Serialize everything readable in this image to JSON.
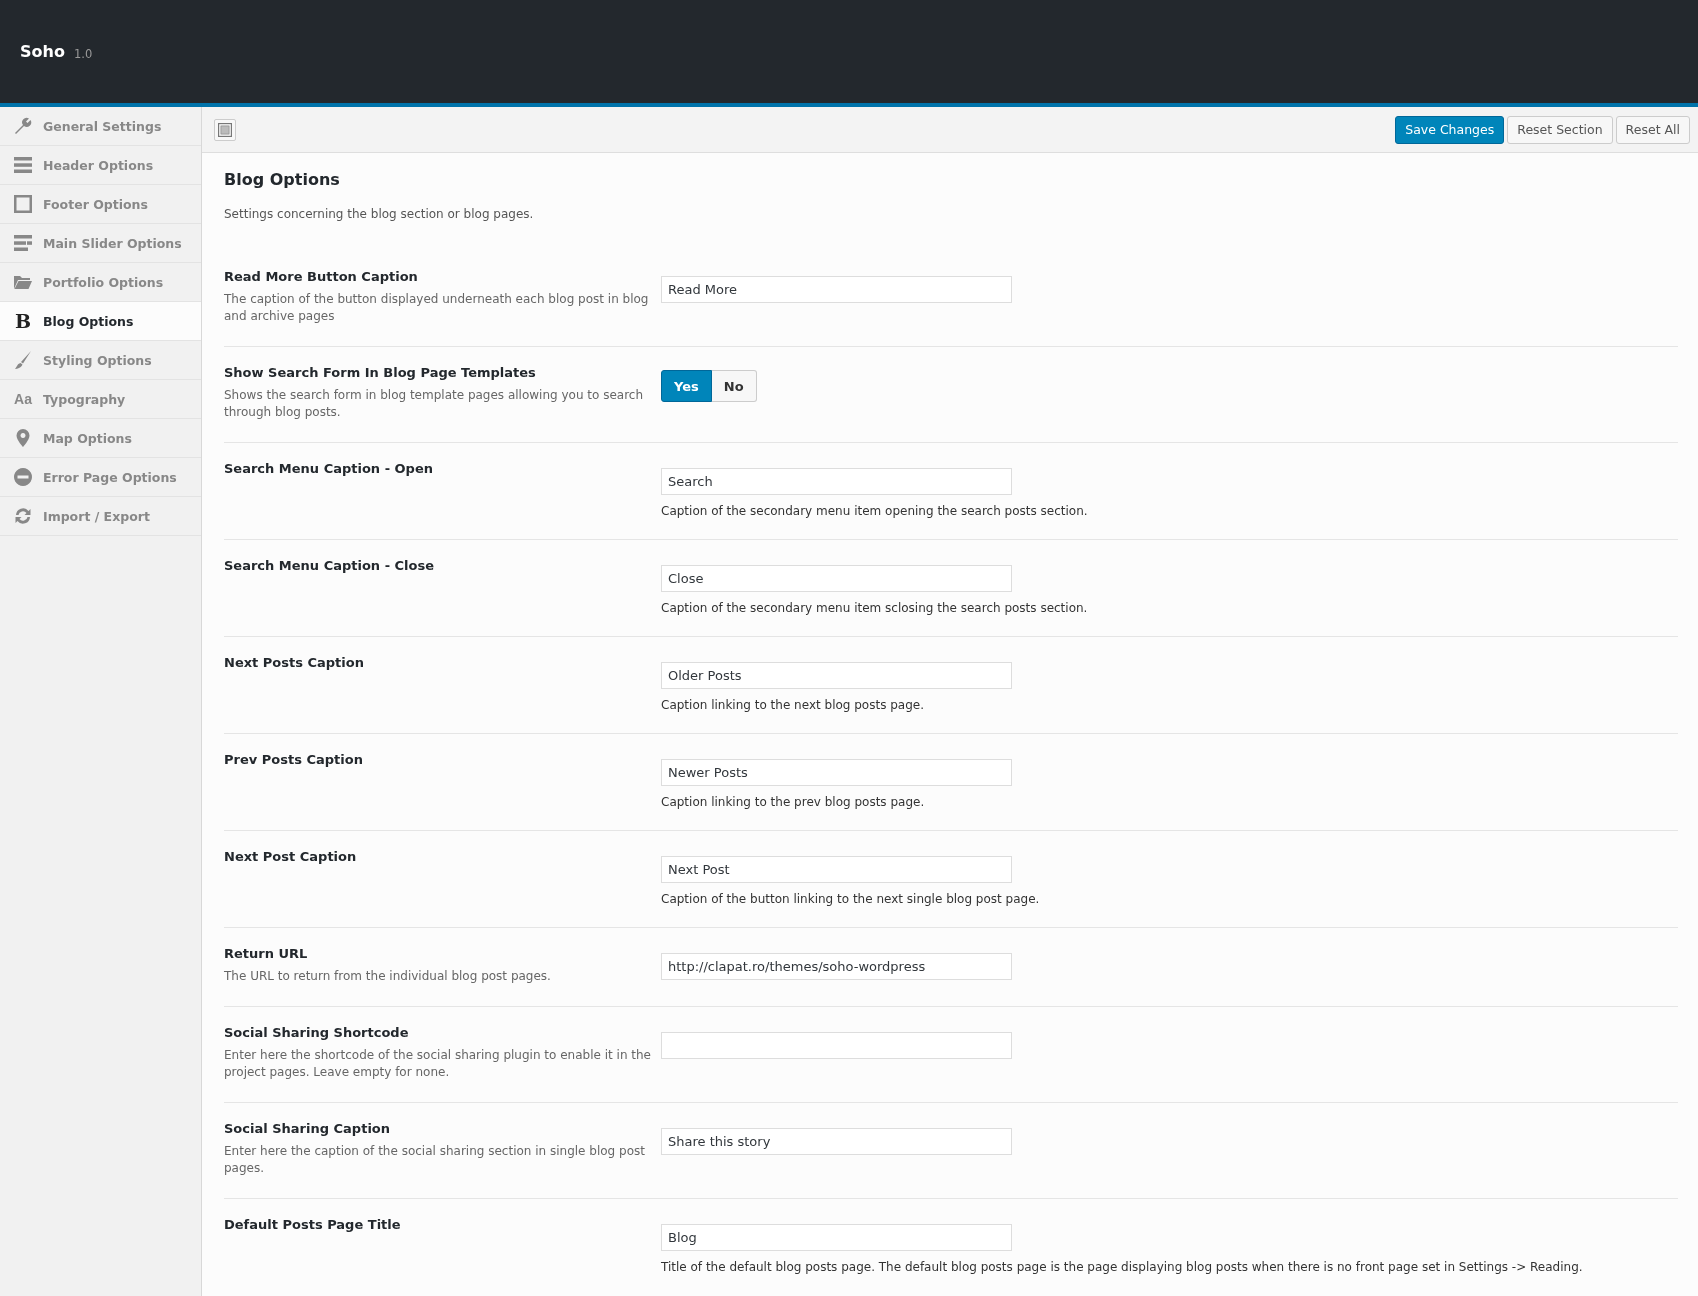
{
  "header": {
    "title": "Soho",
    "version": "1.0"
  },
  "sidebar": {
    "items": [
      {
        "label": "General Settings",
        "selected": false
      },
      {
        "label": "Header Options",
        "selected": false
      },
      {
        "label": "Footer Options",
        "selected": false
      },
      {
        "label": "Main Slider Options",
        "selected": false
      },
      {
        "label": "Portfolio Options",
        "selected": false
      },
      {
        "label": "Blog Options",
        "glyph": "B",
        "selected": true
      },
      {
        "label": "Styling Options",
        "selected": false
      },
      {
        "label": "Typography",
        "glyph": "Aa",
        "selected": false
      },
      {
        "label": "Map Options",
        "selected": false
      },
      {
        "label": "Error Page Options",
        "selected": false
      },
      {
        "label": "Import / Export",
        "selected": false
      }
    ]
  },
  "toolbar": {
    "buttons": [
      {
        "label": "Save Changes",
        "kind": "primary"
      },
      {
        "label": "Reset Section",
        "kind": "secondary"
      },
      {
        "label": "Reset All",
        "kind": "secondary"
      }
    ]
  },
  "section": {
    "title": "Blog Options",
    "description": "Settings concerning the blog section or blog pages.",
    "fields": [
      {
        "kind": "text",
        "label": "Read More Button Caption",
        "description": "The caption of the button displayed underneath each blog post in blog and archive pages",
        "value": "Read More"
      },
      {
        "kind": "toggle",
        "label": "Show Search Form In Blog Page Templates",
        "description": "Shows the search form in blog template pages allowing you to search through blog posts.",
        "options": [
          {
            "label": "Yes",
            "selected": true
          },
          {
            "label": "No",
            "selected": false
          }
        ]
      },
      {
        "kind": "text",
        "label": "Search Menu Caption - Open",
        "value": "Search",
        "hint": "Caption of the secondary menu item opening the search posts section."
      },
      {
        "kind": "text",
        "label": "Search Menu Caption - Close",
        "value": "Close",
        "hint": "Caption of the secondary menu item sclosing the search posts section."
      },
      {
        "kind": "text",
        "label": "Next Posts Caption",
        "value": "Older Posts",
        "hint": "Caption linking to the next blog posts page."
      },
      {
        "kind": "text",
        "label": "Prev Posts Caption",
        "value": "Newer Posts",
        "hint": "Caption linking to the prev blog posts page."
      },
      {
        "kind": "text",
        "label": "Next Post Caption",
        "value": "Next Post",
        "hint": "Caption of the button linking to the next single blog post page."
      },
      {
        "kind": "text",
        "label": "Return URL",
        "description": "The URL to return from the individual blog post pages.",
        "value": "http://clapat.ro/themes/soho-wordpress"
      },
      {
        "kind": "text",
        "label": "Social Sharing Shortcode",
        "description": "Enter here the shortcode of the social sharing plugin to enable it in the project pages. Leave empty for none."
      },
      {
        "kind": "text",
        "label": "Social Sharing Caption",
        "description": "Enter here the caption of the social sharing section in single blog post pages.",
        "value": "Share this story"
      },
      {
        "kind": "text",
        "label": "Default Posts Page Title",
        "value": "Blog",
        "hint": "Title of the default blog posts page. The default blog posts page is the page displaying blog posts when there is no front page set in Settings -> Reading."
      }
    ]
  }
}
